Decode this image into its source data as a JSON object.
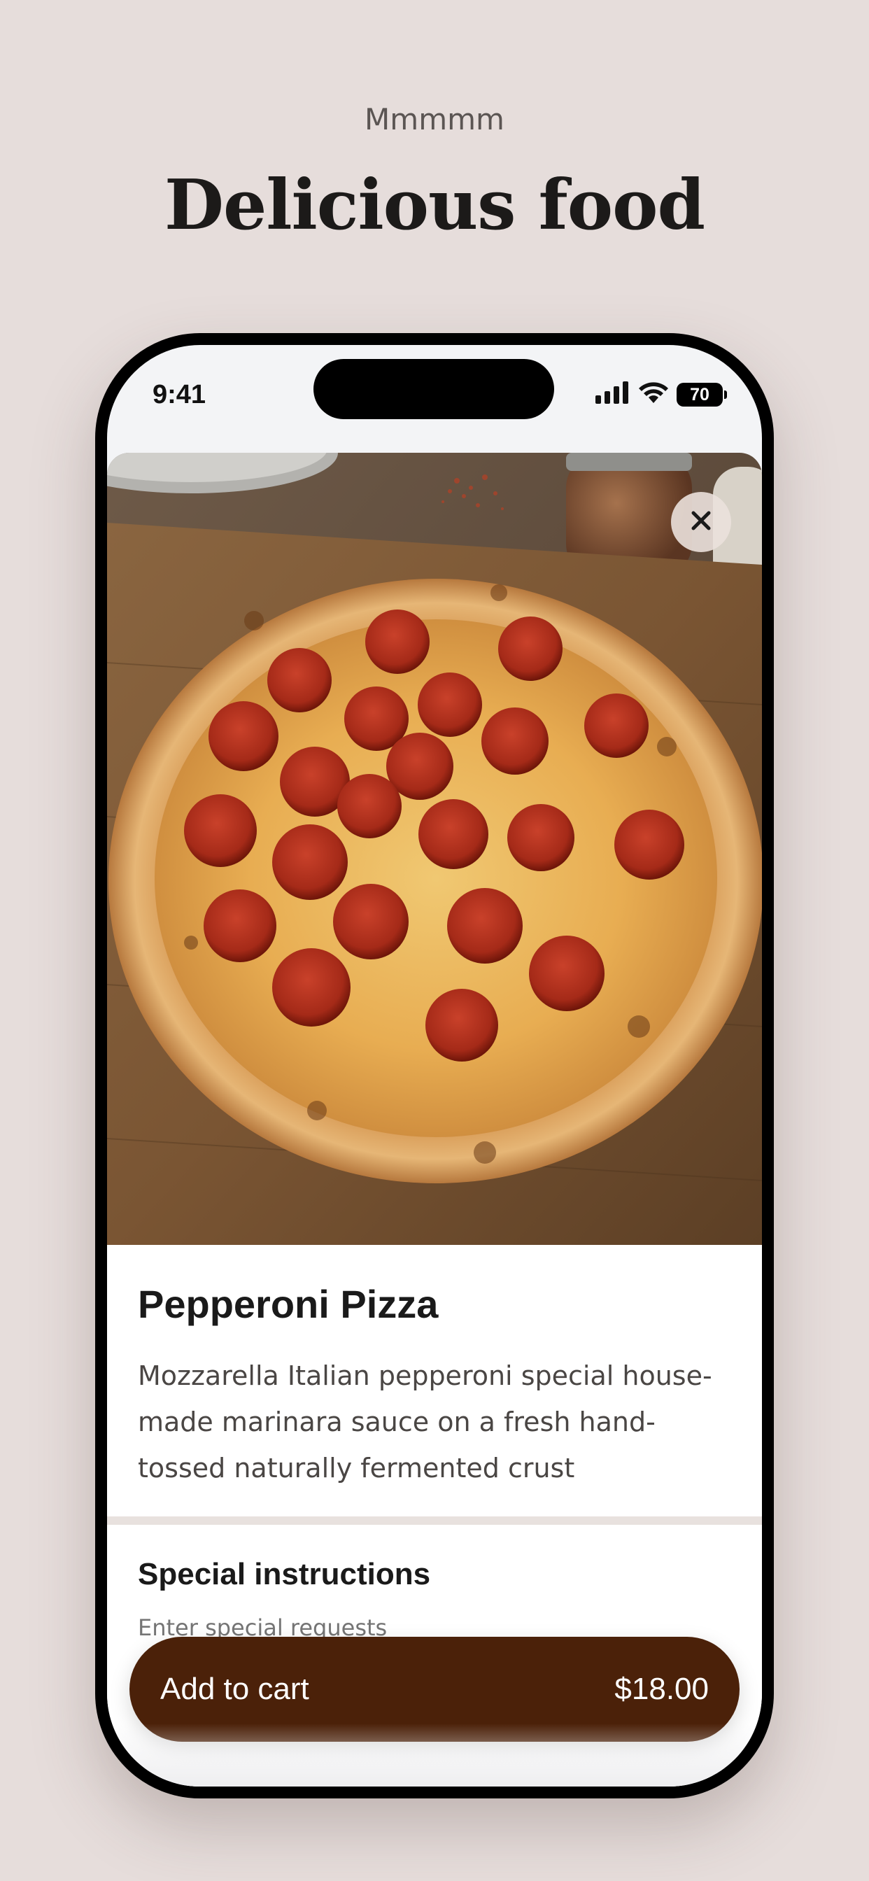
{
  "page": {
    "eyebrow": "Mmmmm",
    "headline": "Delicious food"
  },
  "status_bar": {
    "time": "9:41",
    "battery": "70"
  },
  "product": {
    "image_alt": "Pepperoni pizza on a wooden board",
    "title": "Pepperoni Pizza",
    "description": "Mozzarella Italian pepperoni special house-made marinara sauce on a fresh hand-tossed naturally fermented crust"
  },
  "instructions": {
    "title": "Special instructions",
    "placeholder": "Enter special requests"
  },
  "cart": {
    "label": "Add to cart",
    "price": "$18.00"
  },
  "colors": {
    "background": "#e6dddb",
    "cart_button": "#4b2109",
    "text_primary": "#1a1a1a",
    "text_secondary": "#4a4644"
  },
  "icons": {
    "close": "close-icon",
    "signal": "cellular-signal-icon",
    "wifi": "wifi-icon",
    "battery": "battery-icon"
  }
}
